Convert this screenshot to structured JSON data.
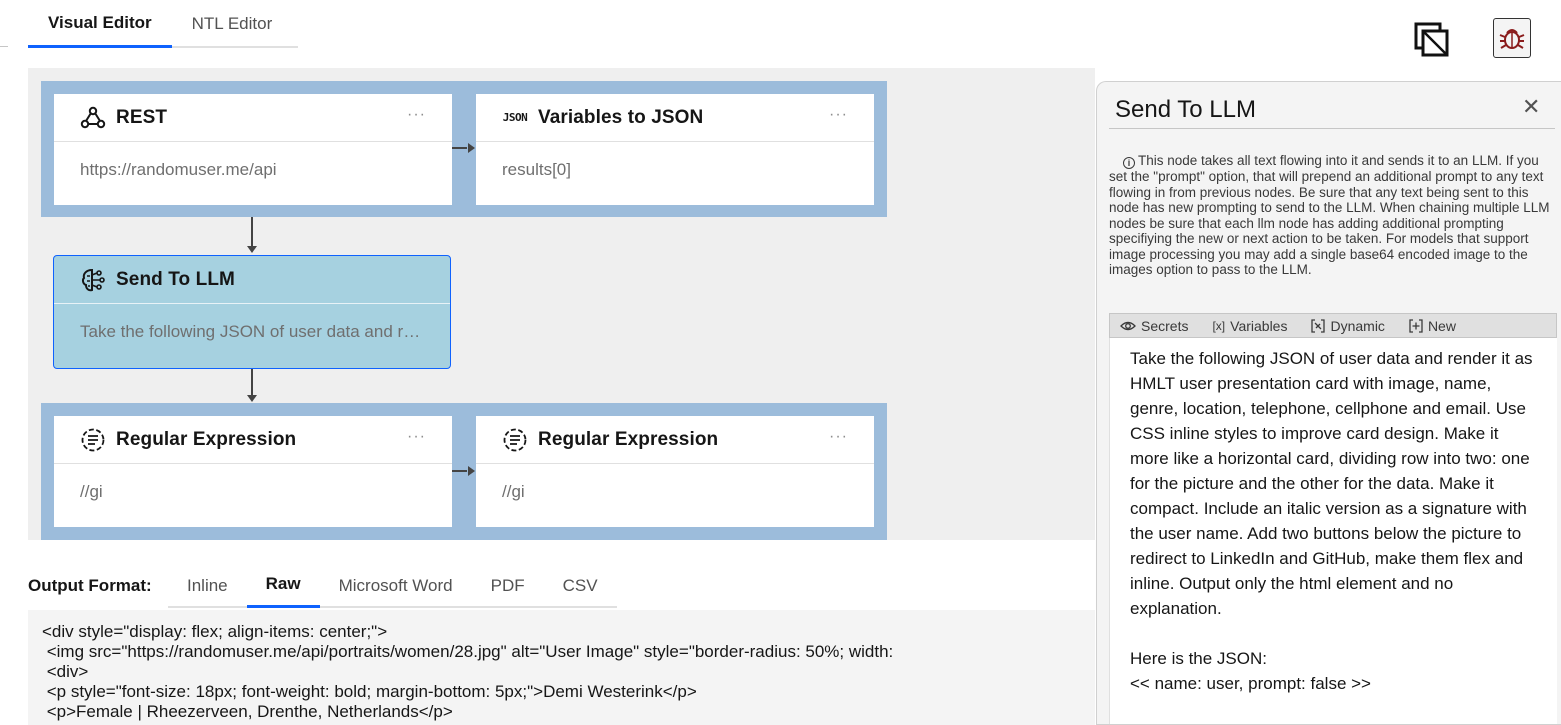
{
  "editor_tabs": [
    {
      "label": "Visual Editor",
      "active": true
    },
    {
      "label": "NTL Editor",
      "active": false
    }
  ],
  "toolbar_icons": [
    "copy-workflow-icon",
    "debug-icon"
  ],
  "nodes": {
    "rest": {
      "title": "REST",
      "icon": "webhook-icon",
      "body": "https://randomuser.me/api"
    },
    "variables": {
      "title": "Variables to JSON",
      "icon": "json-icon",
      "icon_text": "JSON",
      "body": "results[0]"
    },
    "llm": {
      "title": "Send To LLM",
      "icon": "ai-brain-icon",
      "body": "Take the following JSON of user data and render it as HMLT user presentation card with image, name, genre, location, telephone, cellphone and email."
    },
    "regex1": {
      "title": "Regular Expression",
      "icon": "regex-icon",
      "body": "//gi"
    },
    "regex2": {
      "title": "Regular Expression",
      "icon": "regex-icon",
      "body": "//gi"
    },
    "menu_glyph": "···"
  },
  "output": {
    "label": "Output Format:",
    "tabs": [
      {
        "label": "Inline",
        "active": false
      },
      {
        "label": "Raw",
        "active": true
      },
      {
        "label": "Microsoft Word",
        "active": false
      },
      {
        "label": "PDF",
        "active": false
      },
      {
        "label": "CSV",
        "active": false
      }
    ],
    "code_lines": [
      "<div style=\"display: flex; align-items: center;\">",
      " <img src=\"https://randomuser.me/api/portraits/women/28.jpg\" alt=\"User Image\" style=\"border-radius: 50%; width:",
      " <div>",
      " <p style=\"font-size: 18px; font-weight: bold; margin-bottom: 5px;\">Demi Westerink</p>",
      " <p>Female | Rheezerveen, Drenthe, Netherlands</p>"
    ]
  },
  "panel": {
    "title": "Send To LLM",
    "close": "✕",
    "info_icon": "i",
    "info": "This node takes all text flowing into it and sends it to an LLM. If you set the \"prompt\" option, that will prepend an additional prompt to any text flowing in from previous nodes. Be sure that any text being sent to this node has new prompting to send to the LLM. When chaining multiple LLM nodes be sure that each llm node has adding additional prompting specifiying the new or next action to be taken. For models that support image processing you may add a single base64 encoded image to the images option to pass to the LLM.",
    "toolbar": [
      {
        "label": "Secrets",
        "icon": "eye-icon"
      },
      {
        "label": "Variables",
        "icon": "variable-icon"
      },
      {
        "label": "Dynamic",
        "icon": "dynamic-icon"
      },
      {
        "label": "New",
        "icon": "add-box-icon"
      }
    ],
    "prompt": "Take the following JSON of user data and render it as HMLT user presentation card with image, name, genre, location, telephone, cellphone and email. Use CSS inline styles to improve card design. Make it more like a horizontal card, dividing row into two: one for the picture and the other for the data. Make it compact. Include an italic version as a signature with the user name. Add two buttons below the picture to redirect to LinkedIn and GitHub, make them flex and inline. Output only the html element and no explanation.\n\nHere is the JSON:\n<< name: user, prompt: false >>"
  }
}
